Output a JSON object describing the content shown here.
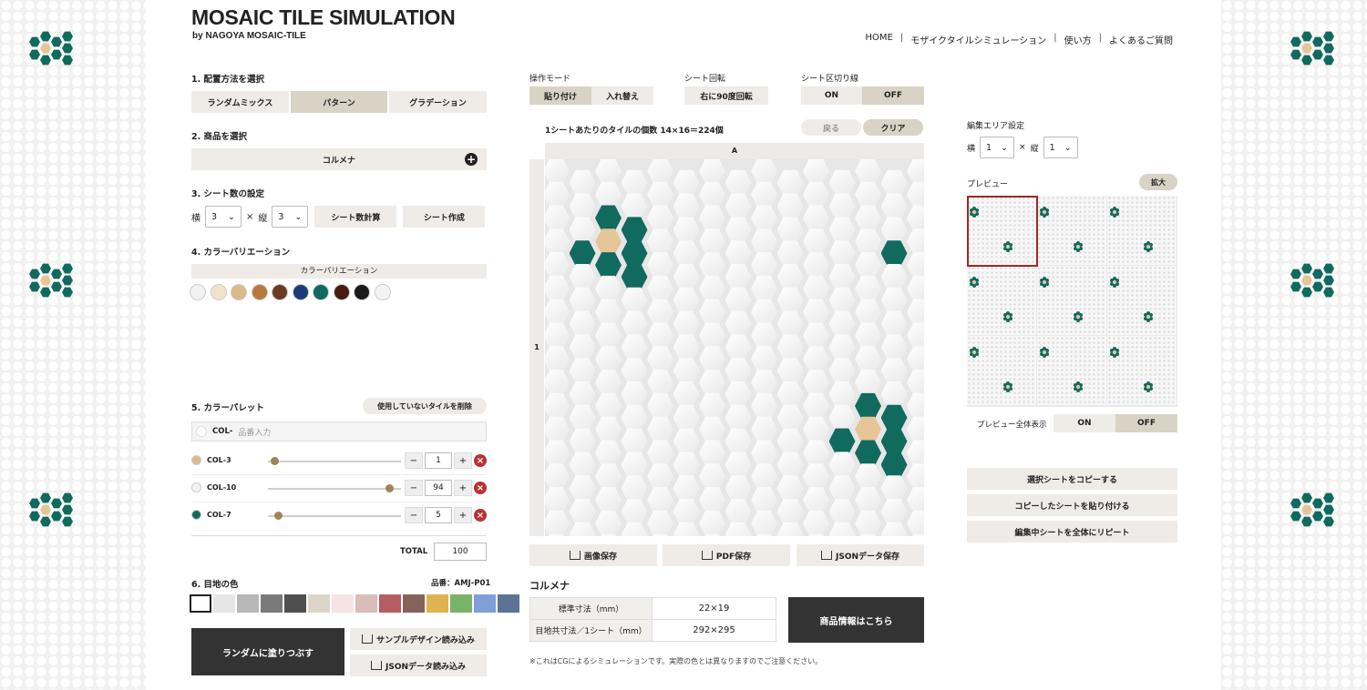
{
  "header": {
    "title": "MOSAIC TILE SIMULATION",
    "subtitle": "by NAGOYA MOSAIC-TILE",
    "nav": [
      "HOME",
      "モザイクタイルシミュレーション",
      "使い方",
      "よくあるご質問"
    ]
  },
  "step1": {
    "label": "1. 配置方法を選択",
    "options": [
      "ランダムミックス",
      "パターン",
      "グラデーション"
    ],
    "selected": 1
  },
  "step2": {
    "label": "2. 商品を選択",
    "product": "コルメナ"
  },
  "step3": {
    "label": "3. シート数の設定",
    "w_label": "横",
    "w_value": "3",
    "times": "×",
    "h_label": "縦",
    "h_value": "3",
    "calc": "シート数計算",
    "create": "シート作成"
  },
  "step4": {
    "label": "4. カラーバリエーション",
    "bar": "カラーバリエーション",
    "colors": [
      "#f2f2f2",
      "#efe4cb",
      "#dcb98a",
      "#b87a3c",
      "#6b3a22",
      "#1c3a78",
      "#116a5e",
      "#4a1a10",
      "#1a1a1a",
      "#f4f4f4"
    ]
  },
  "step5": {
    "label": "5. カラーパレット",
    "remove_btn": "使用していないタイルを削除",
    "input_prefix": "COL-",
    "input_placeholder": "品番入力",
    "rows": [
      {
        "name": "COL-3",
        "color": "#dcb98a",
        "value": "1",
        "pos": 0.02
      },
      {
        "name": "COL-10",
        "color": "#f2f2f2",
        "value": "94",
        "pos": 0.92
      },
      {
        "name": "COL-7",
        "color": "#116a5e",
        "value": "5",
        "pos": 0.05
      }
    ],
    "total_label": "TOTAL",
    "total": "100"
  },
  "step6": {
    "label": "6. 目地の色",
    "code": "品番：AMJ-P01",
    "colors": [
      "#ffffff",
      "#e6e6e6",
      "#b7b7b7",
      "#7a7a7a",
      "#4f4f4f",
      "#ddd6c8",
      "#f6e4e4",
      "#d8bdb8",
      "#b65d62",
      "#86635a",
      "#e0b352",
      "#78b36a",
      "#7ea0d6",
      "#5b7396"
    ]
  },
  "bottom": {
    "random": "ランダムに塗りつぶす",
    "sample": "サンプルデザイン読み込み",
    "json_load": "JSONデータ読み込み"
  },
  "mode": {
    "label": "操作モード",
    "options": [
      "貼り付け",
      "入れ替え"
    ],
    "selected": 0
  },
  "rotate": {
    "label": "シート回転",
    "btn": "右に90度回転"
  },
  "divider": {
    "label": "シート区切り線",
    "options": [
      "ON",
      "OFF"
    ],
    "selected": 1
  },
  "canvas": {
    "count_text": "1シートあたりのタイルの個数 14×16＝224個",
    "back": "戻る",
    "clear": "クリア",
    "col_label": "A",
    "row_label": "1"
  },
  "save": {
    "image": "画像保存",
    "pdf": "PDF保存",
    "json": "JSONデータ保存"
  },
  "product_info": {
    "name": "コルメナ",
    "size_label": "標準寸法（mm）",
    "size_value": "22×19",
    "sheet_label": "目地共寸法／1シート（mm）",
    "sheet_value": "292×295",
    "detail_btn": "商品情報はこちら"
  },
  "note": "※これはCGによるシミュレーションです。実際の色とは異なりますのでご注意ください。",
  "edit_area": {
    "label": "編集エリア設定",
    "w_label": "横",
    "w_value": "1",
    "times": "×",
    "h_label": "縦",
    "h_value": "1"
  },
  "preview": {
    "label": "プレビュー",
    "zoom": "拡大",
    "all_label": "プレビュー全体表示",
    "options": [
      "ON",
      "OFF"
    ],
    "selected": 1
  },
  "actions": [
    "選択シートをコピーする",
    "コピーしたシートを貼り付ける",
    "編集中シートを全体にリピート"
  ],
  "tiles": {
    "white": "#f4f4f4",
    "green": "#116a5e",
    "beige": "#e6c597"
  }
}
